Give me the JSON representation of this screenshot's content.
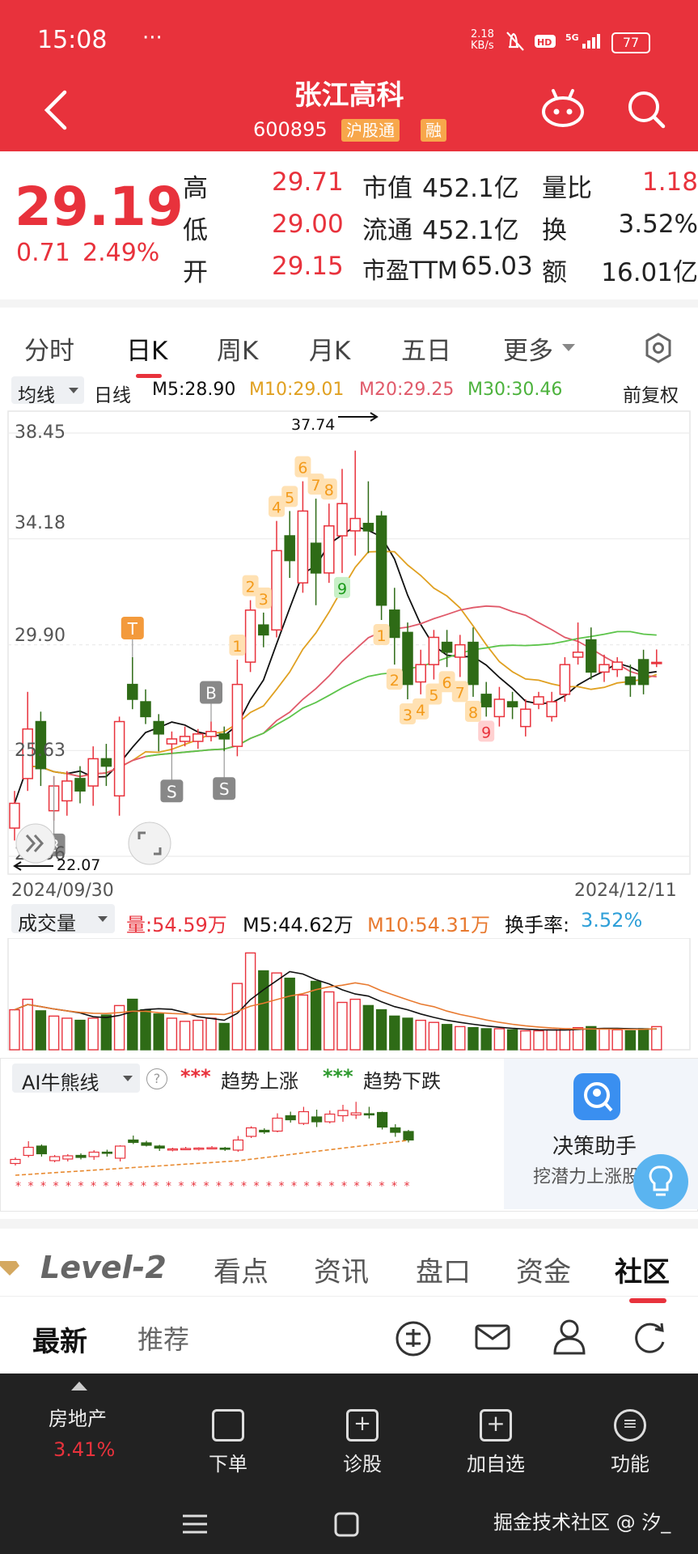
{
  "status_bar": {
    "time": "15:08",
    "dots": "···",
    "speed": "2.18\nKB/s",
    "battery": "77"
  },
  "header": {
    "title": "张江高科",
    "code": "600895",
    "tags": [
      "沪股通",
      "融"
    ]
  },
  "quote": {
    "price": "29.19",
    "change": "0.71",
    "change_pct": "2.49%",
    "rows": [
      {
        "l1": "高",
        "v1": "29.71",
        "l2": "市值",
        "v2": "452.1亿",
        "l3": "量比",
        "v3": "1.18"
      },
      {
        "l1": "低",
        "v1": "29.00",
        "l2": "流通",
        "v2": "452.1亿",
        "l3": "换",
        "v3": "3.52%"
      },
      {
        "l1": "开",
        "v1": "29.15",
        "l2": "市盈TTM",
        "v2": "65.03",
        "l3": "额",
        "v3": "16.01亿"
      }
    ]
  },
  "period_tabs": [
    "分时",
    "日K",
    "周K",
    "月K",
    "五日",
    "更多"
  ],
  "active_tab": "日K",
  "ma_bar": {
    "selector": "均线",
    "type": "日线",
    "m5": "M5:28.90",
    "m10": "M10:29.01",
    "m20": "M20:29.25",
    "m30": "M30:30.46",
    "adjust": "前复权"
  },
  "colors": {
    "up": "#e8323c",
    "down": "#2e6b16",
    "m5": "#111111",
    "m10": "#e0a020",
    "m20": "#e05a6a",
    "m30": "#5cc44a",
    "accent": "#e8323c"
  },
  "chart_data": {
    "type": "candlestick",
    "y_ticks": [
      "38.45",
      "34.18",
      "29.90",
      "25.63",
      "21.36"
    ],
    "ylim": [
      21.36,
      38.45
    ],
    "date_start": "2024/09/30",
    "date_end": "2024/12/11",
    "high_label": "37.74",
    "low_label": "22.07",
    "candles": [
      {
        "o": 22.5,
        "c": 23.5,
        "h": 24.0,
        "l": 22.0
      },
      {
        "o": 24.5,
        "c": 26.5,
        "h": 28.0,
        "l": 24.0
      },
      {
        "o": 26.8,
        "c": 24.9,
        "h": 27.2,
        "l": 24.2
      },
      {
        "o": 23.2,
        "c": 24.2,
        "h": 24.6,
        "l": 22.8
      },
      {
        "o": 23.6,
        "c": 24.4,
        "h": 24.8,
        "l": 23.0
      },
      {
        "o": 24.5,
        "c": 24.0,
        "h": 25.0,
        "l": 23.5
      },
      {
        "o": 24.2,
        "c": 25.3,
        "h": 25.8,
        "l": 23.4
      },
      {
        "o": 25.3,
        "c": 25.0,
        "h": 25.9,
        "l": 24.2
      },
      {
        "o": 23.8,
        "c": 26.8,
        "h": 27.0,
        "l": 23.0
      },
      {
        "o": 28.3,
        "c": 27.7,
        "h": 29.4,
        "l": 27.3
      },
      {
        "o": 27.6,
        "c": 27.0,
        "h": 28.1,
        "l": 26.7
      },
      {
        "o": 26.8,
        "c": 26.3,
        "h": 27.1,
        "l": 25.6
      },
      {
        "o": 25.9,
        "c": 26.1,
        "h": 26.4,
        "l": 25.5
      },
      {
        "o": 26.0,
        "c": 26.2,
        "h": 26.6,
        "l": 25.8
      },
      {
        "o": 26.0,
        "c": 26.3,
        "h": 26.5,
        "l": 25.7
      },
      {
        "o": 26.2,
        "c": 26.4,
        "h": 26.8,
        "l": 26.0
      },
      {
        "o": 26.3,
        "c": 26.1,
        "h": 26.6,
        "l": 25.6
      },
      {
        "o": 25.8,
        "c": 28.3,
        "h": 29.3,
        "l": 25.4
      },
      {
        "o": 29.2,
        "c": 31.3,
        "h": 31.7,
        "l": 28.8
      },
      {
        "o": 30.7,
        "c": 30.3,
        "h": 31.2,
        "l": 29.8
      },
      {
        "o": 30.5,
        "c": 33.7,
        "h": 34.9,
        "l": 30.2
      },
      {
        "o": 34.3,
        "c": 33.3,
        "h": 35.3,
        "l": 32.6
      },
      {
        "o": 32.4,
        "c": 35.3,
        "h": 36.5,
        "l": 32.0
      },
      {
        "o": 34.0,
        "c": 32.8,
        "h": 35.8,
        "l": 31.5
      },
      {
        "o": 32.8,
        "c": 34.7,
        "h": 35.6,
        "l": 32.4
      },
      {
        "o": 34.3,
        "c": 35.6,
        "h": 37.0,
        "l": 32.8
      },
      {
        "o": 34.5,
        "c": 35.0,
        "h": 37.74,
        "l": 33.5
      },
      {
        "o": 34.8,
        "c": 34.5,
        "h": 36.5,
        "l": 33.6
      },
      {
        "o": 35.1,
        "c": 31.5,
        "h": 35.3,
        "l": 30.9
      },
      {
        "o": 31.3,
        "c": 30.2,
        "h": 32.2,
        "l": 29.1
      },
      {
        "o": 30.4,
        "c": 28.3,
        "h": 30.8,
        "l": 27.7
      },
      {
        "o": 28.4,
        "c": 29.1,
        "h": 29.7,
        "l": 27.9
      },
      {
        "o": 29.1,
        "c": 30.2,
        "h": 30.5,
        "l": 28.5
      },
      {
        "o": 30.0,
        "c": 29.6,
        "h": 30.5,
        "l": 29.0
      },
      {
        "o": 29.4,
        "c": 29.9,
        "h": 30.3,
        "l": 28.6
      },
      {
        "o": 30.0,
        "c": 28.3,
        "h": 30.6,
        "l": 27.8
      },
      {
        "o": 27.9,
        "c": 27.4,
        "h": 28.4,
        "l": 27.0
      },
      {
        "o": 27.0,
        "c": 27.7,
        "h": 28.2,
        "l": 26.6
      },
      {
        "o": 27.6,
        "c": 27.4,
        "h": 28.0,
        "l": 26.9
      },
      {
        "o": 26.6,
        "c": 27.3,
        "h": 27.7,
        "l": 26.2
      },
      {
        "o": 27.5,
        "c": 27.8,
        "h": 28.0,
        "l": 27.3
      },
      {
        "o": 27.0,
        "c": 27.6,
        "h": 28.0,
        "l": 26.8
      },
      {
        "o": 27.9,
        "c": 29.1,
        "h": 29.4,
        "l": 27.6
      },
      {
        "o": 29.4,
        "c": 29.6,
        "h": 30.8,
        "l": 29.1
      },
      {
        "o": 30.1,
        "c": 28.8,
        "h": 30.6,
        "l": 28.5
      },
      {
        "o": 28.8,
        "c": 29.1,
        "h": 29.5,
        "l": 28.4
      },
      {
        "o": 28.9,
        "c": 29.2,
        "h": 29.4,
        "l": 28.6
      },
      {
        "o": 28.6,
        "c": 28.3,
        "h": 29.1,
        "l": 27.8
      },
      {
        "o": 29.3,
        "c": 28.3,
        "h": 29.7,
        "l": 27.9
      },
      {
        "o": 29.15,
        "c": 29.19,
        "h": 29.71,
        "l": 29.0
      }
    ],
    "badges_top": [
      {
        "i": 17,
        "t": "1"
      },
      {
        "i": 18,
        "t": "2"
      },
      {
        "i": 19,
        "t": "3"
      },
      {
        "i": 20,
        "t": "4"
      },
      {
        "i": 21,
        "t": "5"
      },
      {
        "i": 22,
        "t": "6"
      },
      {
        "i": 23,
        "t": "7"
      },
      {
        "i": 24,
        "t": "8"
      }
    ],
    "badges_green": [
      {
        "i": 25,
        "t": "9"
      }
    ],
    "badges_bottom": [
      {
        "i": 28,
        "t": "1"
      },
      {
        "i": 29,
        "t": "2"
      },
      {
        "i": 30,
        "t": "3"
      },
      {
        "i": 31,
        "t": "4"
      },
      {
        "i": 32,
        "t": "5"
      },
      {
        "i": 33,
        "t": "6"
      },
      {
        "i": 34,
        "t": "7"
      },
      {
        "i": 35,
        "t": "8"
      }
    ],
    "badges_pink": [
      {
        "i": 36,
        "t": "9"
      }
    ],
    "markers": [
      {
        "i": 9,
        "t": "T",
        "style": "orange"
      },
      {
        "i": 15,
        "t": "B",
        "style": "gray"
      },
      {
        "i": 3,
        "t": "B",
        "style": "gray"
      },
      {
        "i": 12,
        "t": "S",
        "style": "gray"
      },
      {
        "i": 16,
        "t": "S",
        "style": "gray"
      }
    ]
  },
  "volume": {
    "selector": "成交量",
    "vol": "量:54.59万",
    "m5": "M5:44.62万",
    "m10": "M10:54.31万",
    "turnover_label": "换手率:",
    "turnover": "3.52%",
    "values": [
      38,
      48,
      37,
      32,
      30,
      28,
      30,
      33,
      42,
      48,
      38,
      34,
      30,
      27,
      28,
      30,
      25,
      63,
      92,
      75,
      73,
      68,
      52,
      65,
      55,
      45,
      48,
      42,
      38,
      32,
      30,
      28,
      26,
      24,
      22,
      21,
      20,
      20,
      19,
      18,
      18,
      19,
      20,
      21,
      22,
      20,
      19,
      18,
      20,
      22
    ]
  },
  "ai": {
    "selector": "AI牛熊线",
    "help": "?",
    "stars": "***",
    "up_label": "趋势上涨",
    "down_label": "趋势下跌",
    "assistant_title": "决策助手",
    "assistant_sub": "挖潜力上涨股"
  },
  "sub_tabs": [
    "Level-2",
    "看点",
    "资讯",
    "盘口",
    "资金",
    "社区"
  ],
  "active_sub_tab": "社区",
  "feed_tabs": [
    "最新",
    "推荐"
  ],
  "bottom_nav": {
    "sector": "房地产",
    "sector_pct": "3.41%",
    "items": [
      "下单",
      "诊股",
      "加自选",
      "功能"
    ]
  },
  "watermark": "掘金技术社区 @ 汐_"
}
